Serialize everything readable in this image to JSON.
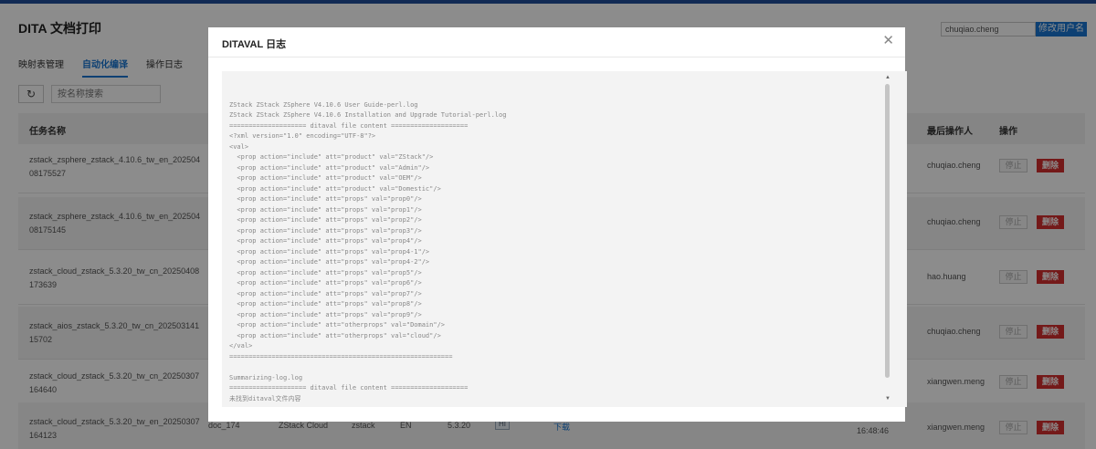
{
  "app": {
    "title": "DITA 文档打印",
    "username": "chuqiao.cheng",
    "change_user_label": "修改用户名",
    "tabs": [
      {
        "label": "映射表管理",
        "active": false
      },
      {
        "label": "自动化编译",
        "active": true
      },
      {
        "label": "操作日志",
        "active": false
      }
    ],
    "search_placeholder": "按名称搜索",
    "refresh_icon": "refresh-icon",
    "columns": {
      "task_name": "任务名称",
      "last_operator": "最后操作人",
      "actions": "操作"
    },
    "stop_label": "停止",
    "delete_label": "删除",
    "rows": [
      {
        "name": "zstack_zsphere_zstack_4.10.6_tw_en_20250408175527",
        "user": "chuqiao.cheng"
      },
      {
        "name": "zstack_zsphere_zstack_4.10.6_tw_en_20250408175145",
        "user": "chuqiao.cheng"
      },
      {
        "name": "zstack_cloud_zstack_5.3.20_tw_cn_20250408173639",
        "user": "hao.huang"
      },
      {
        "name": "zstack_aios_zstack_5.3.20_tw_cn_20250314115702",
        "user": "chuqiao.cheng"
      },
      {
        "name": "zstack_cloud_zstack_5.3.20_tw_cn_20250307164640",
        "user": "xiangwen.meng"
      },
      {
        "name": "zstack_cloud_zstack_5.3.20_tw_en_20250307164123",
        "user": "xiangwen.meng",
        "doc": "doc_174",
        "product": "ZStack Cloud",
        "brand": "zstack",
        "lang": "EN",
        "version": "5.3.20",
        "badge": "HI",
        "link": "下载",
        "time": "16:48:46"
      }
    ]
  },
  "modal": {
    "title": "DITAVAL 日志",
    "close_icon": "close-icon",
    "log_lines": [
      "",
      "ZStack ZStack ZSphere V4.10.6 User Guide-perl.log",
      "ZStack ZStack ZSphere V4.10.6 Installation and Upgrade Tutorial-perl.log",
      "==================== ditaval file content ====================",
      "<?xml version=\"1.0\" encoding=\"UTF-8\"?>",
      "<val>",
      "  <prop action=\"include\" att=\"product\" val=\"ZStack\"/>",
      "  <prop action=\"include\" att=\"product\" val=\"Admin\"/>",
      "  <prop action=\"include\" att=\"product\" val=\"OEM\"/>",
      "  <prop action=\"include\" att=\"product\" val=\"Domestic\"/>",
      "  <prop action=\"include\" att=\"props\" val=\"prop0\"/>",
      "  <prop action=\"include\" att=\"props\" val=\"prop1\"/>",
      "  <prop action=\"include\" att=\"props\" val=\"prop2\"/>",
      "  <prop action=\"include\" att=\"props\" val=\"prop3\"/>",
      "  <prop action=\"include\" att=\"props\" val=\"prop4\"/>",
      "  <prop action=\"include\" att=\"props\" val=\"prop4-1\"/>",
      "  <prop action=\"include\" att=\"props\" val=\"prop4-2\"/>",
      "  <prop action=\"include\" att=\"props\" val=\"prop5\"/>",
      "  <prop action=\"include\" att=\"props\" val=\"prop6\"/>",
      "  <prop action=\"include\" att=\"props\" val=\"prop7\"/>",
      "  <prop action=\"include\" att=\"props\" val=\"prop8\"/>",
      "  <prop action=\"include\" att=\"props\" val=\"prop9\"/>",
      "  <prop action=\"include\" att=\"otherprops\" val=\"Domain\"/>",
      "  <prop action=\"include\" att=\"otherprops\" val=\"cloud\"/>",
      "</val>",
      "==========================================================",
      "",
      "Summarizing-log.log",
      "==================== ditaval file content ====================",
      "未找到ditaval文件内容"
    ]
  }
}
